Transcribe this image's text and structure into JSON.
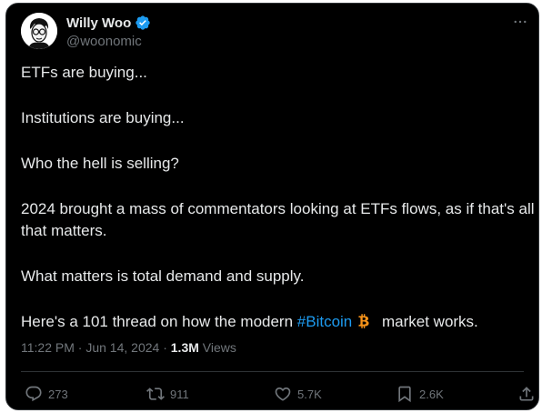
{
  "author": {
    "name": "Willy Woo",
    "handle": "@woonomic",
    "verified": true
  },
  "tweet": {
    "paragraphs": [
      "ETFs are buying...",
      "Institutions are buying...",
      "Who the hell is selling?",
      "2024 brought a mass of commentators looking at ETFs flows, as if that's all that matters.",
      "What matters is total demand and supply."
    ],
    "last_line_prefix": "Here's a 101 thread on how the modern ",
    "hashtag": "#Bitcoin",
    "last_line_suffix": " market works."
  },
  "meta": {
    "time": "11:22 PM",
    "separator": " · ",
    "date": "Jun 14, 2024",
    "dot": " · ",
    "views_count": "1.3M",
    "views_label": " Views"
  },
  "actions": {
    "replies": "273",
    "reposts": "911",
    "likes": "5.7K",
    "bookmarks": "2.6K"
  },
  "icons": {
    "verified": "verified-badge-icon",
    "more": "more-dots-icon",
    "bitcoin": "bitcoin-emoji-icon",
    "reply": "reply-icon",
    "repost": "repost-icon",
    "like": "heart-icon",
    "bookmark": "bookmark-icon",
    "share": "share-icon"
  },
  "colors": {
    "background": "#000000",
    "text": "#e7e9ea",
    "muted": "#71767b",
    "link": "#1d9bf0",
    "verified": "#1d9bf0",
    "bitcoin": "#f7931a"
  }
}
